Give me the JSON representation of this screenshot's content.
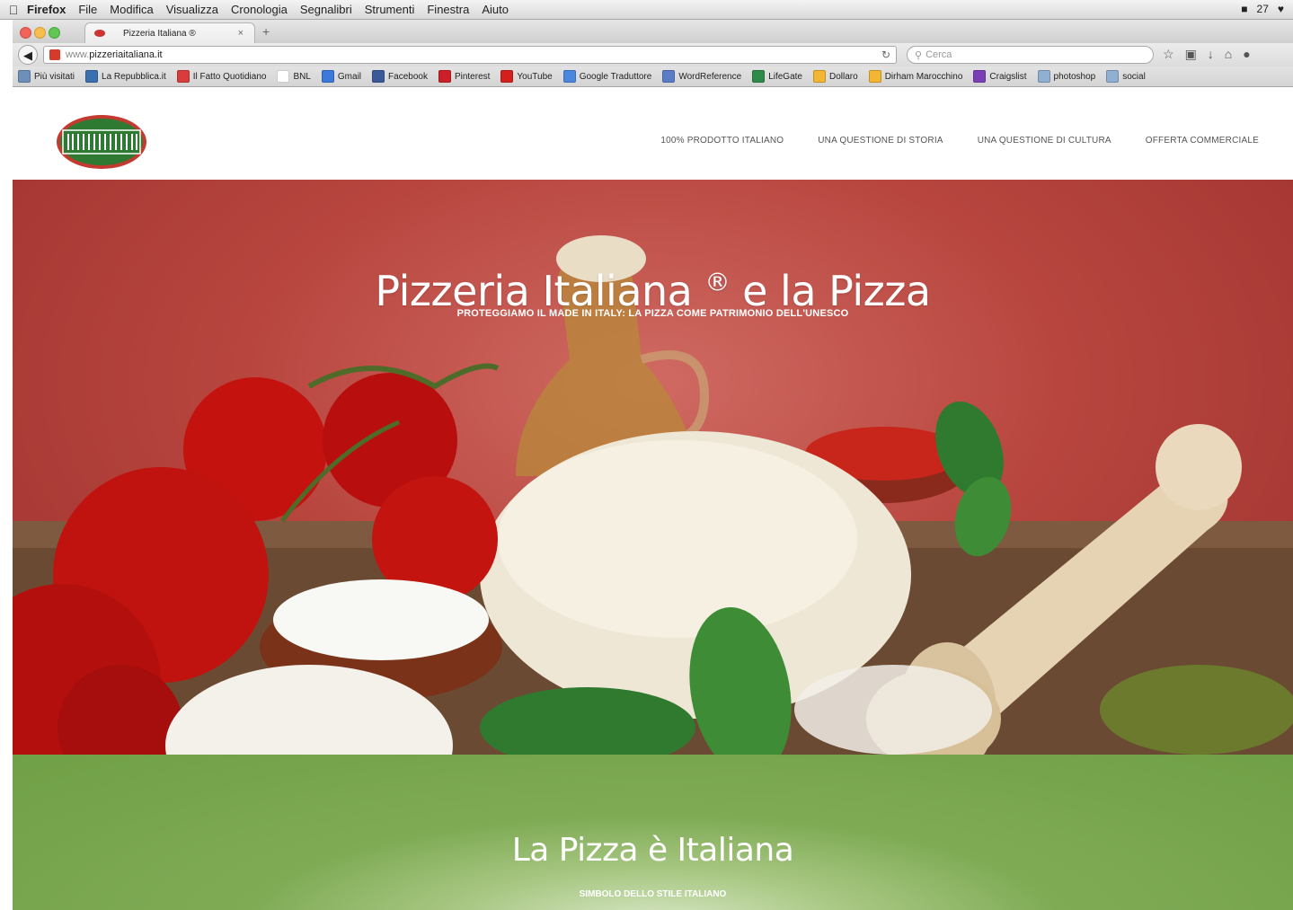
{
  "os_menu": {
    "app": "Firefox",
    "items": [
      "File",
      "Modifica",
      "Visualizza",
      "Cronologia",
      "Segnalibri",
      "Strumenti",
      "Finestra",
      "Aiuto"
    ],
    "status_right": "27"
  },
  "browser": {
    "tab_title": "Pizzeria Italiana ®",
    "url_prefix": "www.",
    "url_domain": "pizzeriaitaliana.it",
    "search_placeholder": "Cerca",
    "bookmarks": [
      {
        "label": "Più visitati",
        "color": "#6d8fb8"
      },
      {
        "label": "La Repubblica.it",
        "color": "#3a6fb0"
      },
      {
        "label": "Il Fatto Quotidiano",
        "color": "#d93c3c"
      },
      {
        "label": "BNL",
        "color": "#ffffff"
      },
      {
        "label": "Gmail",
        "color": "#3d79d8"
      },
      {
        "label": "Facebook",
        "color": "#3b5998"
      },
      {
        "label": "Pinterest",
        "color": "#cb2027"
      },
      {
        "label": "YouTube",
        "color": "#d3201d"
      },
      {
        "label": "Google Traduttore",
        "color": "#4a88e0"
      },
      {
        "label": "WordReference",
        "color": "#5a7cc4"
      },
      {
        "label": "LifeGate",
        "color": "#2e8b4a"
      },
      {
        "label": "Dollaro",
        "color": "#f2b632"
      },
      {
        "label": "Dirham Marocchino",
        "color": "#f2b632"
      },
      {
        "label": "Craigslist",
        "color": "#7b3fb5"
      },
      {
        "label": "photoshop",
        "color": "#8fb0d3"
      },
      {
        "label": "social",
        "color": "#8fb0d3"
      }
    ]
  },
  "site": {
    "logo_text": "PIZZERIA ITALIANA",
    "nav": [
      "100% PRODOTTO ITALIANO",
      "UNA QUESTIONE DI STORIA",
      "UNA QUESTIONE DI CULTURA",
      "OFFERTA COMMERCIALE"
    ],
    "hero": {
      "title": "Pizzeria Italiana",
      "title_mark": "®",
      "title_suffix": " e la Pizza",
      "subtitle": "PROTEGGIAMO IL MADE IN ITALY: LA PIZZA COME PATRIMONIO DELL'UNESCO"
    },
    "section2": {
      "title": "La Pizza è Italiana",
      "subtitle": "SIMBOLO DELLO STILE ITALIANO"
    },
    "colors": {
      "hero_red": "#b8463f",
      "green": "#7fab55",
      "logo_green": "#2f7a32",
      "logo_red": "#c23a30"
    }
  }
}
